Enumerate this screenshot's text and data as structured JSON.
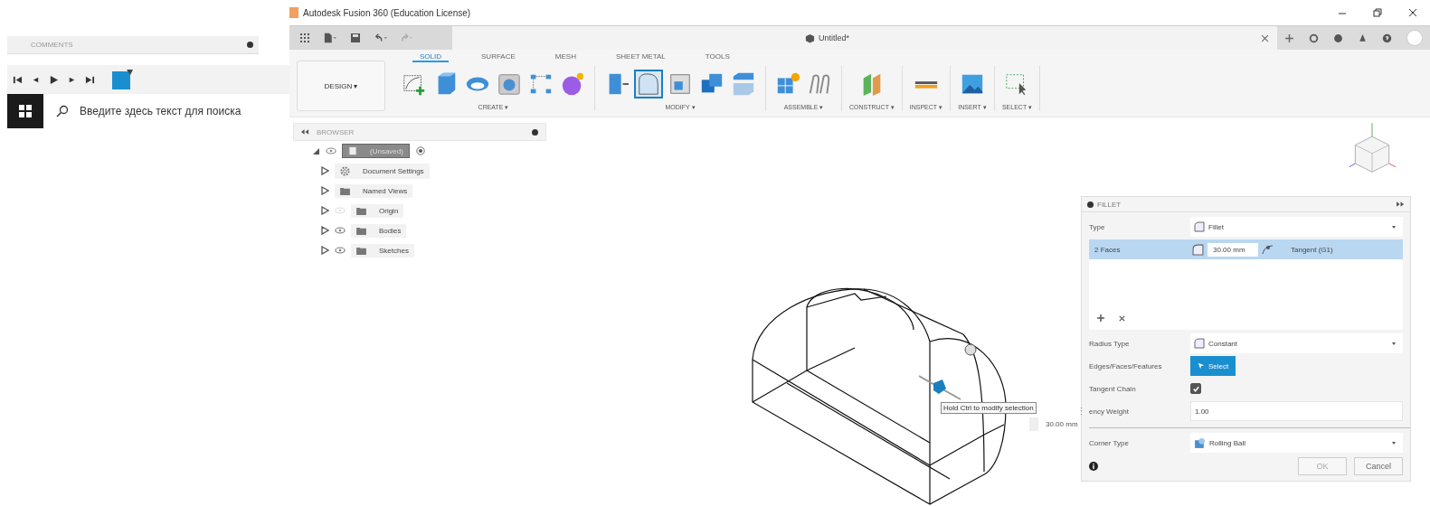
{
  "left_panel": {
    "comments": {
      "title": "COMMENTS"
    },
    "taskbar": {
      "search_placeholder": "Введите здесь текст для поиска"
    }
  },
  "window": {
    "title": "Autodesk Fusion 360 (Education License)"
  },
  "document_tab": {
    "title": "Untitled*"
  },
  "workspace": {
    "label": "DESIGN ▾"
  },
  "tabs": [
    {
      "label": "SOLID",
      "selected": true
    },
    {
      "label": "SURFACE",
      "selected": false
    },
    {
      "label": "MESH",
      "selected": false
    },
    {
      "label": "SHEET METAL",
      "selected": false
    },
    {
      "label": "TOOLS",
      "selected": false
    }
  ],
  "groups": [
    {
      "label": "CREATE ▾",
      "tools": [
        {
          "kind": "sketch",
          "selected": false
        },
        {
          "kind": "box",
          "selected": false
        },
        {
          "kind": "revolve",
          "selected": false
        },
        {
          "kind": "hole",
          "selected": false
        },
        {
          "kind": "pattern",
          "selected": false
        },
        {
          "kind": "form",
          "selected": false
        }
      ]
    },
    {
      "label": "MODIFY ▾",
      "tools": [
        {
          "kind": "presspull",
          "selected": false
        },
        {
          "kind": "fillet",
          "selected": true
        },
        {
          "kind": "shell",
          "selected": false
        },
        {
          "kind": "combine",
          "selected": false
        },
        {
          "kind": "split",
          "selected": false
        }
      ]
    },
    {
      "label": "ASSEMBLE ▾",
      "tools": [
        {
          "kind": "component",
          "selected": false
        },
        {
          "kind": "joint",
          "selected": false
        }
      ]
    },
    {
      "label": "CONSTRUCT ▾",
      "tools": [
        {
          "kind": "plane",
          "selected": false
        }
      ]
    },
    {
      "label": "INSPECT ▾",
      "tools": [
        {
          "kind": "measure",
          "selected": false
        }
      ]
    },
    {
      "label": "INSERT ▾",
      "tools": [
        {
          "kind": "image",
          "selected": false
        }
      ]
    },
    {
      "label": "SELECT ▾",
      "tools": [
        {
          "kind": "select",
          "selected": false
        }
      ]
    }
  ],
  "browser": {
    "title": "BROWSER",
    "root": {
      "label": "(Unsaved)",
      "expanded": true,
      "children": [
        {
          "label": "Document Settings",
          "kind": "settings",
          "expanded": false
        },
        {
          "label": "Named Views",
          "kind": "folder",
          "expanded": false
        },
        {
          "label": "Origin",
          "kind": "folder",
          "visible": false,
          "expanded": false
        },
        {
          "label": "Bodies",
          "kind": "folder",
          "visible": true,
          "expanded": false
        },
        {
          "label": "Sketches",
          "kind": "folder",
          "visible": true,
          "expanded": false
        }
      ]
    }
  },
  "canvas": {
    "tooltip": "Hold Ctrl to modify selection",
    "dimension_value": "30.00 mm"
  },
  "fillet": {
    "title": "FILLET",
    "type": {
      "label": "Type",
      "value": "Fillet"
    },
    "selection_list": {
      "faces": "2 Faces",
      "radius": "30.00 mm",
      "continuity": "Tangent (G1)",
      "selected": true
    },
    "rows": [
      {
        "kind": "dropdown",
        "label": "Radius Type",
        "value": "Constant"
      },
      {
        "kind": "button",
        "label": "Edges/Faces/Features",
        "value": "Select"
      },
      {
        "kind": "checkbox",
        "label": "Tangent Chain",
        "checked": true
      },
      {
        "kind": "input",
        "handle": "⋮",
        "label": "ency Weight",
        "value": "1.00"
      }
    ],
    "corner_type": {
      "label": "Corner Type",
      "value": "Rolling Ball"
    },
    "buttons": [
      "OK",
      "Cancel"
    ]
  }
}
